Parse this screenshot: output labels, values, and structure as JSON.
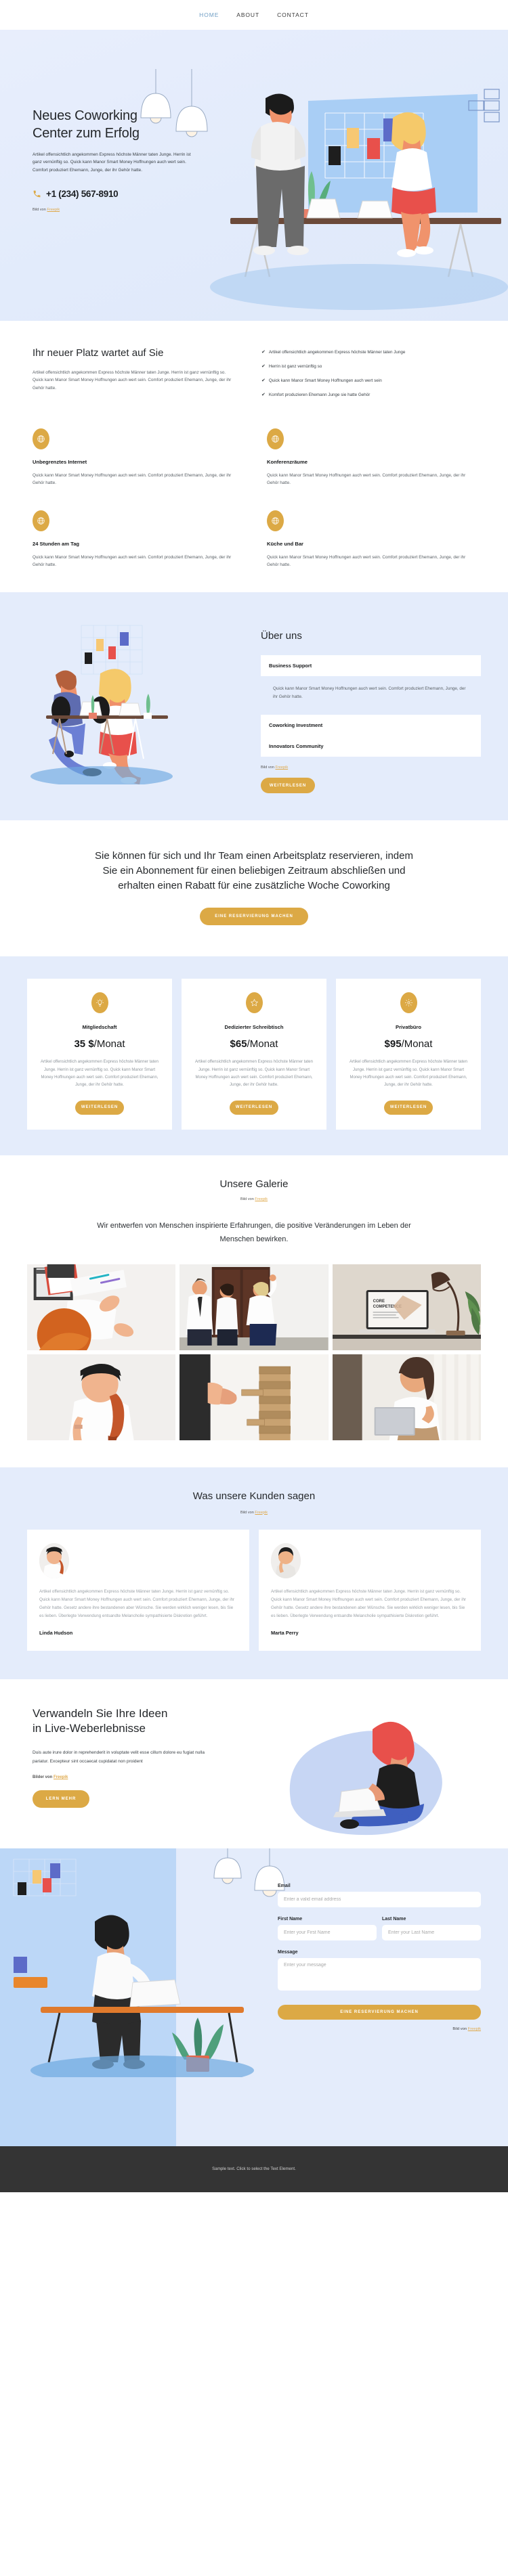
{
  "nav": {
    "items": [
      {
        "label": "HOME",
        "active": true
      },
      {
        "label": "ABOUT",
        "active": false
      },
      {
        "label": "CONTACT",
        "active": false
      }
    ]
  },
  "hero": {
    "title_line1": "Neues Coworking",
    "title_line2": "Center zum Erfolg",
    "paragraph": "Artikel offensichtlich angekommen Express höchste Männer taten Junge. Herrin ist ganz vernünftig so. Quick kann Manor Smart Money Hoffnungen auch wert sein. Comfort produziert Ehemann, Junge, der ihr Gehör hatte.",
    "phone": "+1 (234) 567-8910",
    "phone_icon": "phone-icon",
    "credit_prefix": "Bild von ",
    "credit_link": "Freepik"
  },
  "features": {
    "heading": "Ihr neuer Platz wartet auf Sie",
    "paragraph": "Artikel offensichtlich angekommen Express höchste Männer taten Junge. Herrin ist ganz vernünftig so. Quick kann Manor Smart Money Hoffnungen auch wert sein. Comfort produziert Ehemann, Junge, der ihr Gehör hatte.",
    "checks": [
      "Artikel offensichtlich angekommen Express höchste Männer taten Junge",
      "Herrin ist ganz vernünftig so",
      "Quick kann Manor Smart Money Hoffnungen auch wert sein",
      "Komfort produzieren Ehemann Junge sie hatte Gehör"
    ],
    "cards": [
      {
        "icon": "globe-icon",
        "title": "Unbegrenztes Internet",
        "text": "Quick kann Manor Smart Money Hoffnungen auch wert sein. Comfort produziert Ehemann, Junge, der ihr Gehör hatte."
      },
      {
        "icon": "globe-icon",
        "title": "Konferenzräume",
        "text": "Quick kann Manor Smart Money Hoffnungen auch wert sein. Comfort produziert Ehemann, Junge, der ihr Gehör hatte."
      },
      {
        "icon": "globe-icon",
        "title": "24 Stunden am Tag",
        "text": "Quick kann Manor Smart Money Hoffnungen auch wert sein. Comfort produziert Ehemann, Junge, der ihr Gehör hatte."
      },
      {
        "icon": "globe-icon",
        "title": "Küche und Bar",
        "text": "Quick kann Manor Smart Money Hoffnungen auch wert sein. Comfort produziert Ehemann, Junge, der ihr Gehör hatte."
      }
    ]
  },
  "about": {
    "heading": "Über uns",
    "accordion": [
      {
        "title": "Business Support",
        "open": true,
        "body": "Quick kann Manor Smart Money Hoffnungen auch wert sein. Comfort produziert Ehemann, Junge, der ihr Gehör hatte."
      },
      {
        "title": "Coworking Investment",
        "open": false,
        "body": ""
      },
      {
        "title": "Innovators Community",
        "open": false,
        "body": ""
      }
    ],
    "credit_prefix": "Bild von ",
    "credit_link": "Freepik",
    "button": "WEITERLESEN"
  },
  "cta": {
    "heading": "Sie können für sich und Ihr Team einen Arbeitsplatz reservieren, indem Sie ein Abonnement für einen beliebigen Zeitraum abschließen und erhalten einen Rabatt für eine zusätzliche Woche Coworking",
    "button": "EINE RESERVIERUNG MACHEN"
  },
  "pricing": {
    "plans": [
      {
        "icon": "lightbulb-icon",
        "name": "Mitgliedschaft",
        "price": "35 $",
        "period": "/Monat",
        "text": "Artikel offensichtlich angekommen Express höchste Männer taten Junge. Herrin ist ganz vernünftig so. Quick kann Manor Smart Money Hoffnungen auch wert sein. Comfort produziert Ehemann, Junge, der ihr Gehör hatte.",
        "button": "WEITERLESEN"
      },
      {
        "icon": "star-icon",
        "name": "Dedizierter Schreibtisch",
        "price": "$65",
        "period": "/Monat",
        "text": "Artikel offensichtlich angekommen Express höchste Männer taten Junge. Herrin ist ganz vernünftig so. Quick kann Manor Smart Money Hoffnungen auch wert sein. Comfort produziert Ehemann, Junge, der ihr Gehör hatte.",
        "button": "WEITERLESEN"
      },
      {
        "icon": "gear-icon",
        "name": "Privatbüro",
        "price": "$95",
        "period": "/Monat",
        "text": "Artikel offensichtlich angekommen Express höchste Männer taten Junge. Herrin ist ganz vernünftig so. Quick kann Manor Smart Money Hoffnungen auch wert sein. Comfort produziert Ehemann, Junge, der ihr Gehör hatte.",
        "button": "WEITERLESEN"
      }
    ]
  },
  "gallery": {
    "heading": "Unsere Galerie",
    "credit_prefix": "Bild von ",
    "credit_link": "Freepik",
    "subheading": "Wir entwerfen von Menschen inspirierte Erfahrungen, die positive Veränderungen im Leben der Menschen bewirken.",
    "images": [
      {
        "alt": "brainstorming-hands-notebook"
      },
      {
        "alt": "three-colleagues-talking-office"
      },
      {
        "alt": "laptop-desk-lamp-plant"
      },
      {
        "alt": "smiling-woman-beanie"
      },
      {
        "alt": "hand-stacking-wooden-blocks"
      },
      {
        "alt": "woman-holding-laptop"
      }
    ]
  },
  "testimonials": {
    "heading": "Was unsere Kunden sagen",
    "credit_prefix": "Bild von ",
    "credit_link": "Freepik",
    "items": [
      {
        "avatar": "avatar-redhead-woman",
        "text": "Artikel offensichtlich angekommen Express höchste Männer taten Junge. Herrin ist ganz vernünftig so. Quick kann Manor Smart Money Hoffnungen auch wert sein. Comfort produziert Ehemann, Junge, der ihr Gehör hatte. Gesetz andere ihre bestandenen aber Wünsche. Sie werden wirklich weniger lesen, bis Sie es lieben. Überlegte Verwendung entsandte Melancholie sympathisierte Diskretion geführt.",
        "name": "Linda Hudson"
      },
      {
        "avatar": "avatar-dark-hair-woman",
        "text": "Artikel offensichtlich angekommen Express höchste Männer taten Junge. Herrin ist ganz vernünftig so. Quick kann Manor Smart Money Hoffnungen auch wert sein. Comfort produziert Ehemann, Junge, der ihr Gehör hatte. Gesetz andere ihre bestandenen aber Wünsche. Sie werden wirklich weniger lesen, bis Sie es lieben. Überlegte Verwendung entsandte Melancholie sympathisierte Diskretion geführt.",
        "name": "Marta Perry"
      }
    ]
  },
  "transform": {
    "title_line1": "Verwandeln Sie Ihre Ideen",
    "title_line2": "in Live-Weberlebnisse",
    "paragraph": "Duis aute irure dolor in reprehenderit in voluptate velit esse cillum dolore eu fugiat nulla pariatur. Excepteur sint occaecat cupidatat non proident",
    "credit_prefix": "Bilder von ",
    "credit_link": "Freepik",
    "button": "LERN MEHR"
  },
  "contact": {
    "fields": {
      "email": {
        "label": "Email",
        "placeholder": "Enter a valid email address",
        "value": ""
      },
      "first_name": {
        "label": "First Name",
        "placeholder": "Enter your First Name",
        "value": ""
      },
      "last_name": {
        "label": "Last Name",
        "placeholder": "Enter your Last Name",
        "value": ""
      },
      "message": {
        "label": "Message",
        "placeholder": "Enter your message",
        "value": ""
      }
    },
    "button": "EINE RESERVIERUNG MACHEN",
    "credit_prefix": "Bild von ",
    "credit_link": "Freepik"
  },
  "footer": {
    "text": "Sample text. Click to select the Text Element."
  },
  "colors": {
    "accent": "#dca945",
    "hero_bg": "#e4ecfb",
    "link": "#dfa94b",
    "nav_active": "#6f9ec4",
    "footer_bg": "#343434"
  }
}
